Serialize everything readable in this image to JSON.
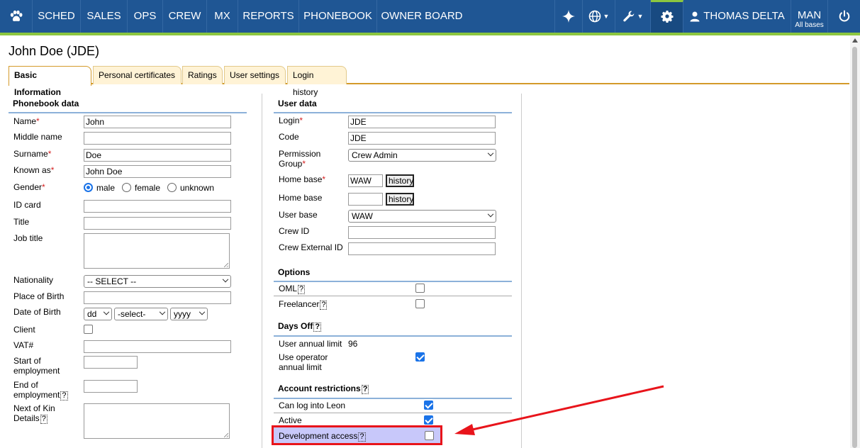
{
  "nav": {
    "logo_icon": "paw-icon",
    "items": [
      "SCHED",
      "SALES",
      "OPS",
      "CREW",
      "MX",
      "REPORTS",
      "PHONEBOOK",
      "OWNER BOARD"
    ],
    "user_name": "THOMAS DELTA",
    "base_code": "MAN",
    "base_sub": "All bases",
    "icons": [
      "sparkle-icon",
      "globe-icon",
      "wrench-icon",
      "gear-icon",
      "user-icon",
      "power-icon"
    ],
    "colors": {
      "bar": "#1f5694",
      "accent": "#8cc63f"
    }
  },
  "page": {
    "title": "John Doe (JDE)",
    "tabs": [
      "Basic Information",
      "Personal certificates",
      "Ratings",
      "User settings",
      "Login history"
    ],
    "active_tab": "Basic Information"
  },
  "phonebook": {
    "heading": "Phonebook data",
    "name_label": "Name",
    "name_value": "John",
    "middle_label": "Middle name",
    "surname_label": "Surname",
    "surname_value": "Doe",
    "known_label": "Known as",
    "known_value": "John Doe",
    "gender_label": "Gender",
    "gender_options": [
      "male",
      "female",
      "unknown"
    ],
    "gender_selected": "male",
    "idcard_label": "ID card",
    "title_label": "Title",
    "jobtitle_label": "Job title",
    "nationality_label": "Nationality",
    "nationality_value": "-- SELECT --",
    "pob_label": "Place of Birth",
    "dob_label": "Date of Birth",
    "dob_day": "dd",
    "dob_month": "-select-",
    "dob_year": "yyyy",
    "client_label": "Client",
    "vat_label": "VAT#",
    "start_label_1": "Start of",
    "start_label_2": "employment",
    "end_label_1": "End of",
    "end_label_2": "employment",
    "kin_label_1": "Next of Kin",
    "kin_label_2": "Details",
    "required_mark": "*",
    "help_mark": "?"
  },
  "userdata": {
    "heading": "User data",
    "login_label": "Login",
    "login_value": "JDE",
    "code_label": "Code",
    "code_value": "JDE",
    "perm_label_1": "Permission",
    "perm_label_2": "Group",
    "perm_value": "Crew Admin",
    "homebase_label": "Home base",
    "homebase_value": "WAW",
    "history_label": "history",
    "homebase2_label": "Home base",
    "userbase_label": "User base",
    "userbase_value": "WAW",
    "crewid_label": "Crew ID",
    "crewext_label": "Crew External ID"
  },
  "options": {
    "heading": "Options",
    "oml_label": "OML",
    "freelancer_label": "Freelancer"
  },
  "daysoff": {
    "heading": "Days Off",
    "annual_label": "User annual limit",
    "annual_value": "96",
    "use_op_label_1": "Use operator",
    "use_op_label_2": "annual limit"
  },
  "restrictions": {
    "heading": "Account restrictions",
    "login_leon_label": "Can log into Leon",
    "active_label": "Active",
    "dev_access_label": "Development access",
    "highlight_color": "#e8141b"
  }
}
